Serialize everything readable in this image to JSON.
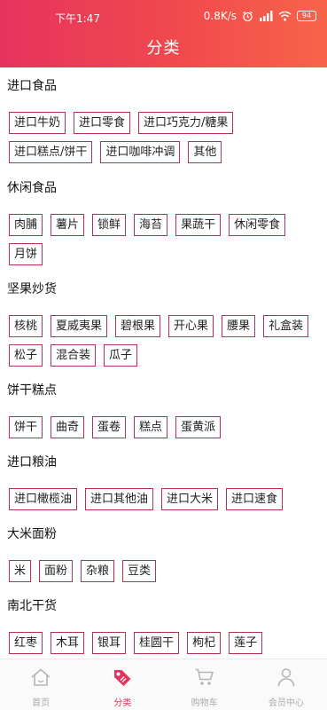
{
  "status": {
    "time": "下午1:47",
    "speed": "0.8K/s",
    "battery": "94"
  },
  "header": {
    "title": "分类"
  },
  "categories": [
    {
      "title": "进口食品",
      "tags": [
        "进口牛奶",
        "进口零食",
        "进口巧克力/糖果",
        "进口糕点/饼干",
        "进口咖啡冲调",
        "其他"
      ]
    },
    {
      "title": "休闲食品",
      "tags": [
        "肉脯",
        "薯片",
        "锁鲜",
        "海苔",
        "果蔬干",
        "休闲零食",
        "月饼"
      ]
    },
    {
      "title": "坚果炒货",
      "tags": [
        "核桃",
        "夏威夷果",
        "碧根果",
        "开心果",
        "腰果",
        "礼盒装",
        "松子",
        "混合装",
        "瓜子"
      ]
    },
    {
      "title": "饼干糕点",
      "tags": [
        "饼干",
        "曲奇",
        "蛋卷",
        "糕点",
        "蛋黄派"
      ]
    },
    {
      "title": "进口粮油",
      "tags": [
        "进口橄榄油",
        "进口其他油",
        "进口大米",
        "进口速食"
      ]
    },
    {
      "title": "大米面粉",
      "tags": [
        "米",
        "面粉",
        "杂粮",
        "豆类"
      ]
    },
    {
      "title": "南北干货",
      "tags": [
        "红枣",
        "木耳",
        "银耳",
        "桂圆干",
        "枸杞",
        "莲子"
      ]
    }
  ],
  "tabbar": {
    "items": [
      {
        "label": "首页",
        "icon": "home-icon",
        "active": false
      },
      {
        "label": "分类",
        "icon": "tag-icon",
        "active": true
      },
      {
        "label": "购物车",
        "icon": "cart-icon",
        "active": false
      },
      {
        "label": "会员中心",
        "icon": "user-icon",
        "active": false
      }
    ],
    "active_color": "#e8325e",
    "inactive_color": "#aaaaaa"
  },
  "colors": {
    "header_start": "#e8325e",
    "header_end": "#f7644a",
    "tag_border": "#b3324f"
  }
}
